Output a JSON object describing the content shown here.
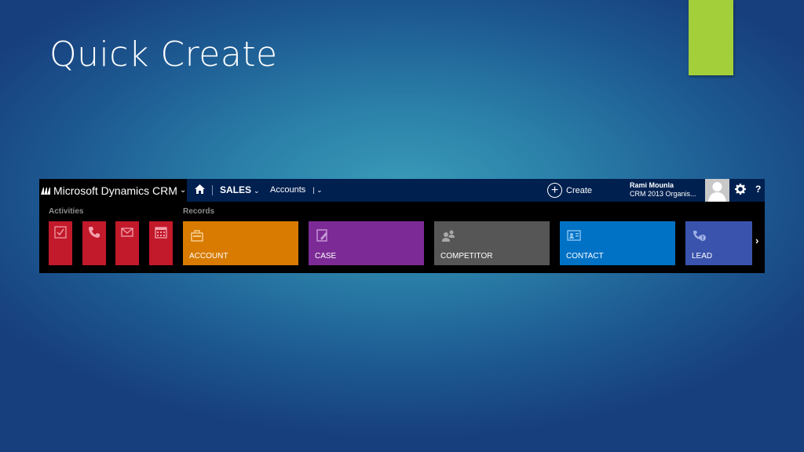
{
  "slide": {
    "title": "Quick Create"
  },
  "crm": {
    "brand": "Microsoft Dynamics CRM",
    "nav": {
      "area": "SALES",
      "entity": "Accounts"
    },
    "create_label": "Create",
    "user": {
      "name": "Rami Mounla",
      "org": "CRM 2013 Organis..."
    },
    "help": "?",
    "sections": {
      "activities": "Activities",
      "records": "Records"
    },
    "records": [
      {
        "label": "ACCOUNT",
        "color": "#d87b00",
        "icon": "account-icon"
      },
      {
        "label": "CASE",
        "color": "#7c2b96",
        "icon": "case-icon"
      },
      {
        "label": "COMPETITOR",
        "color": "#565656",
        "icon": "competitor-icon"
      },
      {
        "label": "CONTACT",
        "color": "#0072c6",
        "icon": "contact-icon"
      },
      {
        "label": "LEAD",
        "color": "#3a53ad",
        "icon": "lead-icon"
      }
    ],
    "activity_color": "#c2192b"
  }
}
